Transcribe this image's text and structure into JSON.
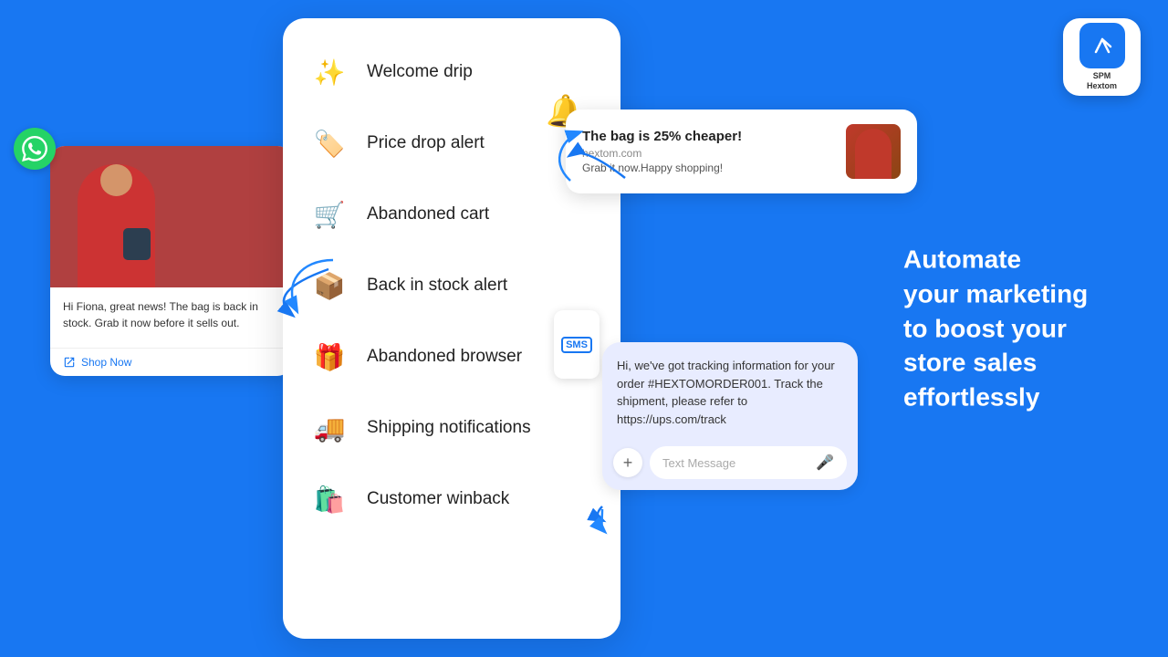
{
  "page": {
    "bg_color": "#1877f2"
  },
  "tagline": {
    "line1": "Automate",
    "line2": "your marketing",
    "line3": "to boost your",
    "line4": "store sales",
    "line5": "effortlessly"
  },
  "spm_logo": {
    "line1": "SPM",
    "line2": "Hextom"
  },
  "menu_items": [
    {
      "id": "welcome-drip",
      "label": "Welcome drip",
      "icon": "✨"
    },
    {
      "id": "price-drop",
      "label": "Price drop alert",
      "icon": "🏷️"
    },
    {
      "id": "abandoned-cart",
      "label": "Abandoned cart",
      "icon": "🛒"
    },
    {
      "id": "back-in-stock",
      "label": "Back in stock alert",
      "icon": "📦"
    },
    {
      "id": "abandoned-browser",
      "label": "Abandoned browser",
      "icon": "🎁"
    },
    {
      "id": "shipping",
      "label": "Shipping notifications",
      "icon": "🚚"
    },
    {
      "id": "winback",
      "label": "Customer winback",
      "icon": "🛍️"
    }
  ],
  "whatsapp_card": {
    "message": "Hi Fiona, great news! The bag is back in stock. Grab it now before it sells out.",
    "cta": "Shop Now"
  },
  "notification": {
    "title": "The bag is 25% cheaper!",
    "url": "hextom.com",
    "message": "Grab it now.Happy shopping!"
  },
  "sms_card": {
    "message": "Hi, we've got tracking information for your order #HEXTOMORDER001. Track the shipment, please refer to https://ups.com/track",
    "input_placeholder": "Text Message",
    "sms_label": "SMS"
  }
}
